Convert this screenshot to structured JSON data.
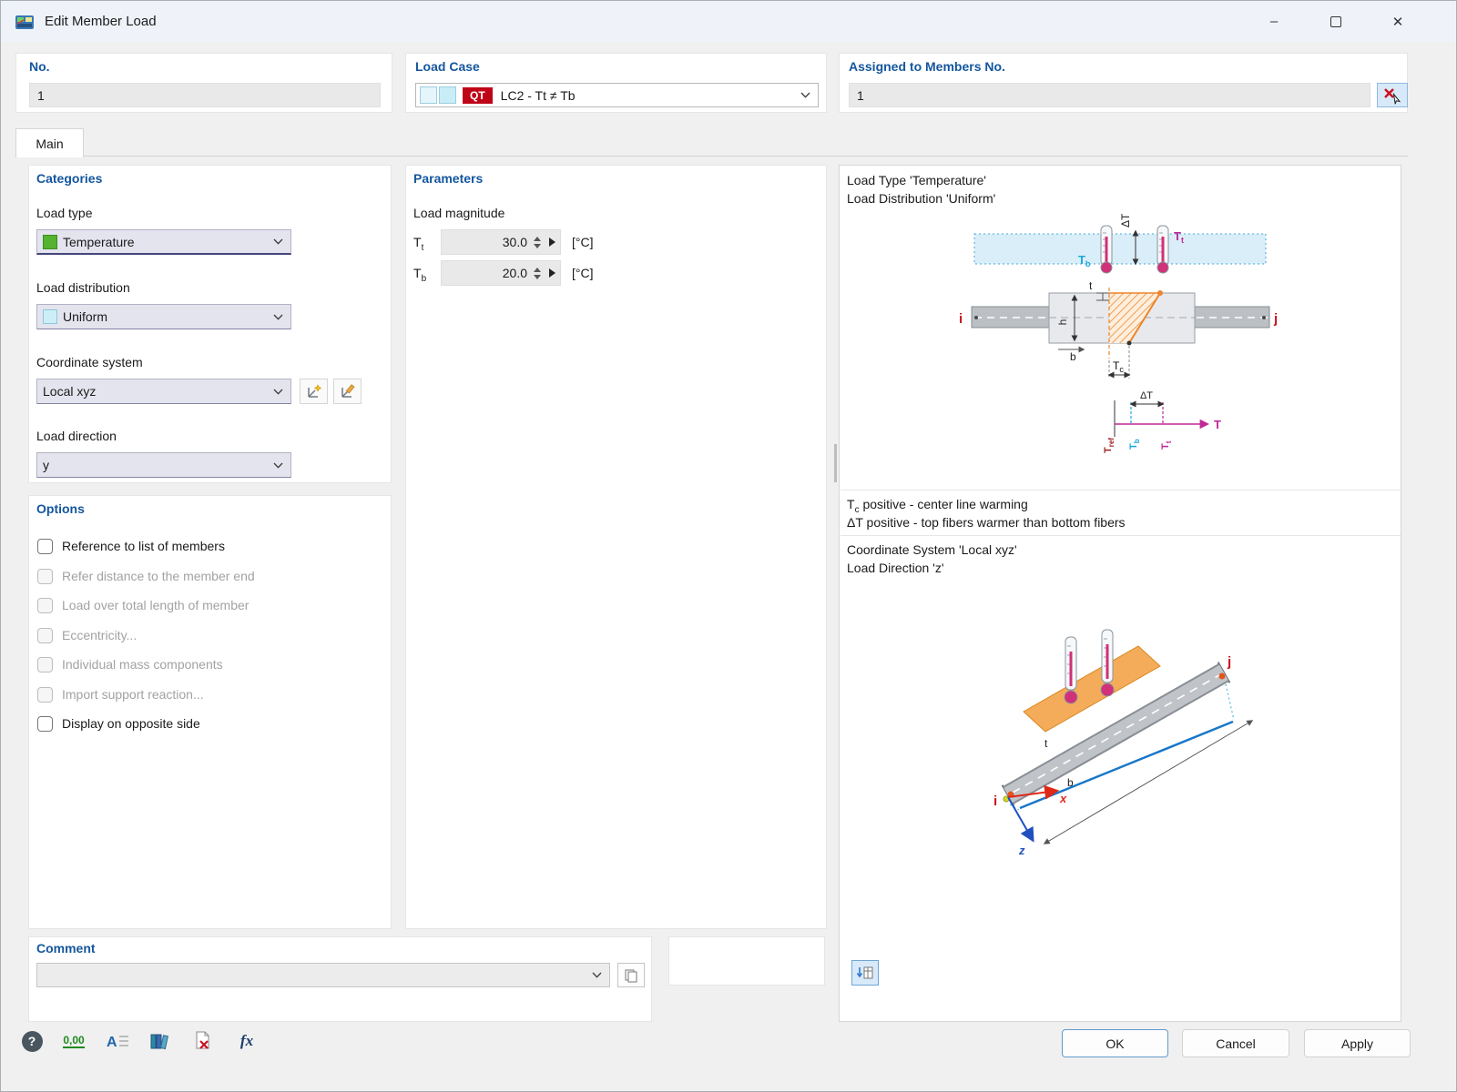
{
  "window": {
    "title": "Edit Member Load"
  },
  "icons": {
    "minimize": "–",
    "close": "✕",
    "chevron_down": "v-chevron",
    "pick": "red-x-cursor",
    "copy": "double-sheet",
    "sync": "table-swap-arrows",
    "thermometer": "thermometer"
  },
  "header": {
    "no": {
      "label": "No.",
      "value": "1"
    },
    "load_case": {
      "label": "Load Case",
      "badge": "QT",
      "value": "LC2 - Tt ≠ Tb"
    },
    "assigned": {
      "label": "Assigned to Members No.",
      "value": "1"
    }
  },
  "tab": {
    "main": "Main"
  },
  "categories": {
    "title": "Categories",
    "load_type": {
      "label": "Load type",
      "value": "Temperature",
      "swatch_color": "#55b32f"
    },
    "load_distribution": {
      "label": "Load distribution",
      "value": "Uniform",
      "swatch_color": "#cdeef7"
    },
    "coordinate_system": {
      "label": "Coordinate system",
      "value": "Local xyz"
    },
    "load_direction": {
      "label": "Load direction",
      "value": "y"
    }
  },
  "options": {
    "title": "Options",
    "items": [
      {
        "label": "Reference to list of members",
        "enabled": true,
        "checked": false
      },
      {
        "label": "Refer distance to the member end",
        "enabled": false,
        "checked": false
      },
      {
        "label": "Load over total length of member",
        "enabled": false,
        "checked": false
      },
      {
        "label": "Eccentricity...",
        "enabled": false,
        "checked": false
      },
      {
        "label": "Individual mass components",
        "enabled": false,
        "checked": false
      },
      {
        "label": "Import support reaction...",
        "enabled": false,
        "checked": false
      },
      {
        "label": "Display on opposite side",
        "enabled": true,
        "checked": false
      }
    ]
  },
  "parameters": {
    "title": "Parameters",
    "group": "Load magnitude",
    "rows": [
      {
        "label_base": "T",
        "label_sub": "t",
        "value": "30.0",
        "unit": "[°C]"
      },
      {
        "label_base": "T",
        "label_sub": "b",
        "value": "20.0",
        "unit": "[°C]"
      }
    ]
  },
  "preview": {
    "caption_load_type": "Load Type 'Temperature'",
    "caption_load_distribution": "Load Distribution 'Uniform'",
    "note_tc_pre": "T",
    "note_tc_sub": "c",
    "note_tc_rest": " positive - center line warming",
    "note_dt": "ΔT positive - top fibers warmer than bottom fibers",
    "caption_coord": "Coordinate System 'Local xyz'",
    "caption_direction": "Load Direction 'z'"
  },
  "diagram1": {
    "dt": "ΔT",
    "tt_base": "T",
    "tt_sub": "t",
    "tb_base": "T",
    "tb_sub": "b",
    "tc_base": "T",
    "tc_sub": "c",
    "tref_base": "T",
    "tref_sub": "ref",
    "axis_t": "T",
    "i": "i",
    "j": "j",
    "t": "t",
    "h": "h",
    "b": "b"
  },
  "diagram2": {
    "i": "i",
    "j": "j",
    "t": "t",
    "b": "b",
    "x": "x",
    "z": "z"
  },
  "comment": {
    "title": "Comment",
    "value": ""
  },
  "toolbar": {
    "help": "?",
    "decimals": "0,00",
    "display_letter": "A",
    "fx": "fx"
  },
  "footer": {
    "ok": "OK",
    "cancel": "Cancel",
    "apply": "Apply"
  }
}
